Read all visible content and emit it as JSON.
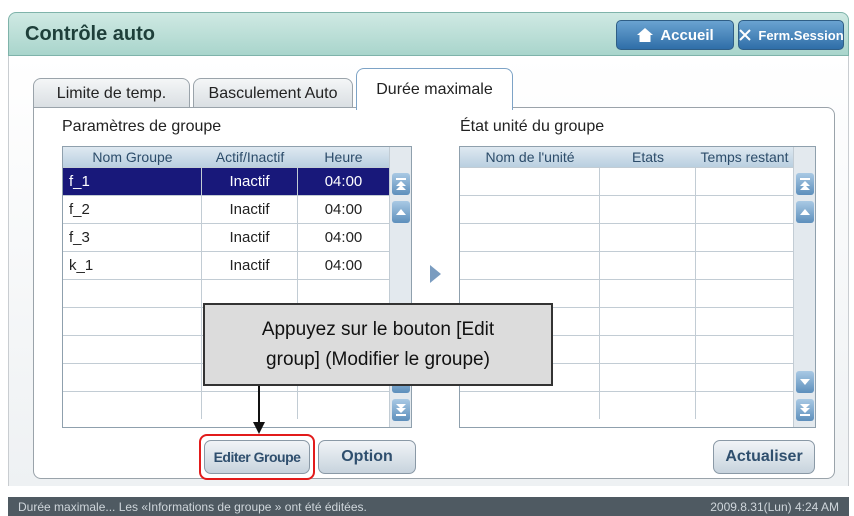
{
  "header": {
    "title": "Contrôle auto",
    "home_label": "Accueil",
    "close_label": "Ferm.Session"
  },
  "tabs": [
    {
      "label": "Limite de temp."
    },
    {
      "label": "Basculement Auto"
    },
    {
      "label": "Durée maximale"
    }
  ],
  "group_params": {
    "title": "Paramètres de groupe",
    "columns": [
      "Nom Groupe",
      "Actif/Inactif",
      "Heure"
    ],
    "rows": [
      {
        "name": "f_1",
        "state": "Inactif",
        "time": "04:00"
      },
      {
        "name": "f_2",
        "state": "Inactif",
        "time": "04:00"
      },
      {
        "name": "f_3",
        "state": "Inactif",
        "time": "04:00"
      },
      {
        "name": "k_1",
        "state": "Inactif",
        "time": "04:00"
      }
    ]
  },
  "unit_state": {
    "title": "État unité du groupe",
    "columns": [
      "Nom de l'unité",
      "Etats",
      "Temps restant"
    ]
  },
  "buttons": {
    "edit_group": "Editer Groupe",
    "option": "Option",
    "refresh": "Actualiser"
  },
  "callout": {
    "line1": "Appuyez sur le bouton [Edit",
    "line2": "group] (Modifier le groupe)"
  },
  "status": {
    "message": "Durée maximale... Les «Informations de groupe » ont été éditées.",
    "datetime": "2009.8.31(Lun)  4:24 AM"
  },
  "colors": {
    "selection": "#18187a",
    "highlight": "#e21b1b",
    "header_bg": "#a9d5cc"
  }
}
